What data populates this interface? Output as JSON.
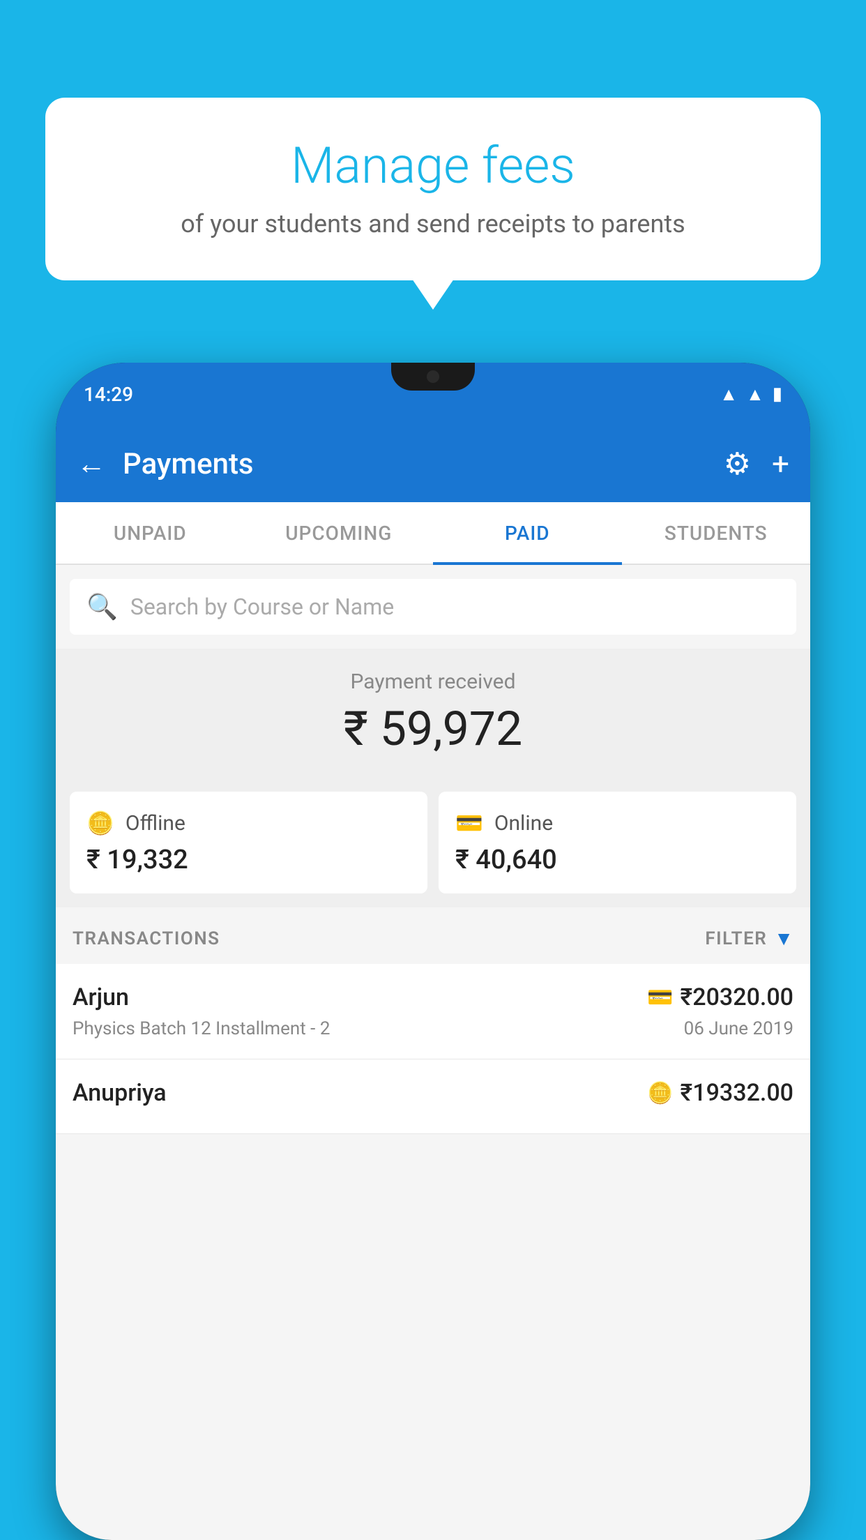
{
  "background_color": "#1ab5e8",
  "speech_bubble": {
    "title": "Manage fees",
    "subtitle": "of your students and send receipts to parents"
  },
  "status_bar": {
    "time": "14:29",
    "wifi_icon": "wifi",
    "signal_icon": "signal",
    "battery_icon": "battery"
  },
  "app_bar": {
    "title": "Payments",
    "back_label": "←",
    "gear_label": "⚙",
    "plus_label": "+"
  },
  "tabs": [
    {
      "label": "UNPAID",
      "active": false
    },
    {
      "label": "UPCOMING",
      "active": false
    },
    {
      "label": "PAID",
      "active": true
    },
    {
      "label": "STUDENTS",
      "active": false
    }
  ],
  "search": {
    "placeholder": "Search by Course or Name"
  },
  "payment_received": {
    "label": "Payment received",
    "amount": "₹ 59,972"
  },
  "payment_methods": [
    {
      "icon": "💳",
      "label": "Offline",
      "amount": "₹ 19,332"
    },
    {
      "icon": "💳",
      "label": "Online",
      "amount": "₹ 40,640"
    }
  ],
  "transactions_section": {
    "label": "TRANSACTIONS",
    "filter_label": "FILTER"
  },
  "transactions": [
    {
      "name": "Arjun",
      "type_icon": "card",
      "amount": "₹20320.00",
      "course": "Physics Batch 12 Installment - 2",
      "date": "06 June 2019"
    },
    {
      "name": "Anupriya",
      "type_icon": "cash",
      "amount": "₹19332.00",
      "course": "",
      "date": ""
    }
  ]
}
